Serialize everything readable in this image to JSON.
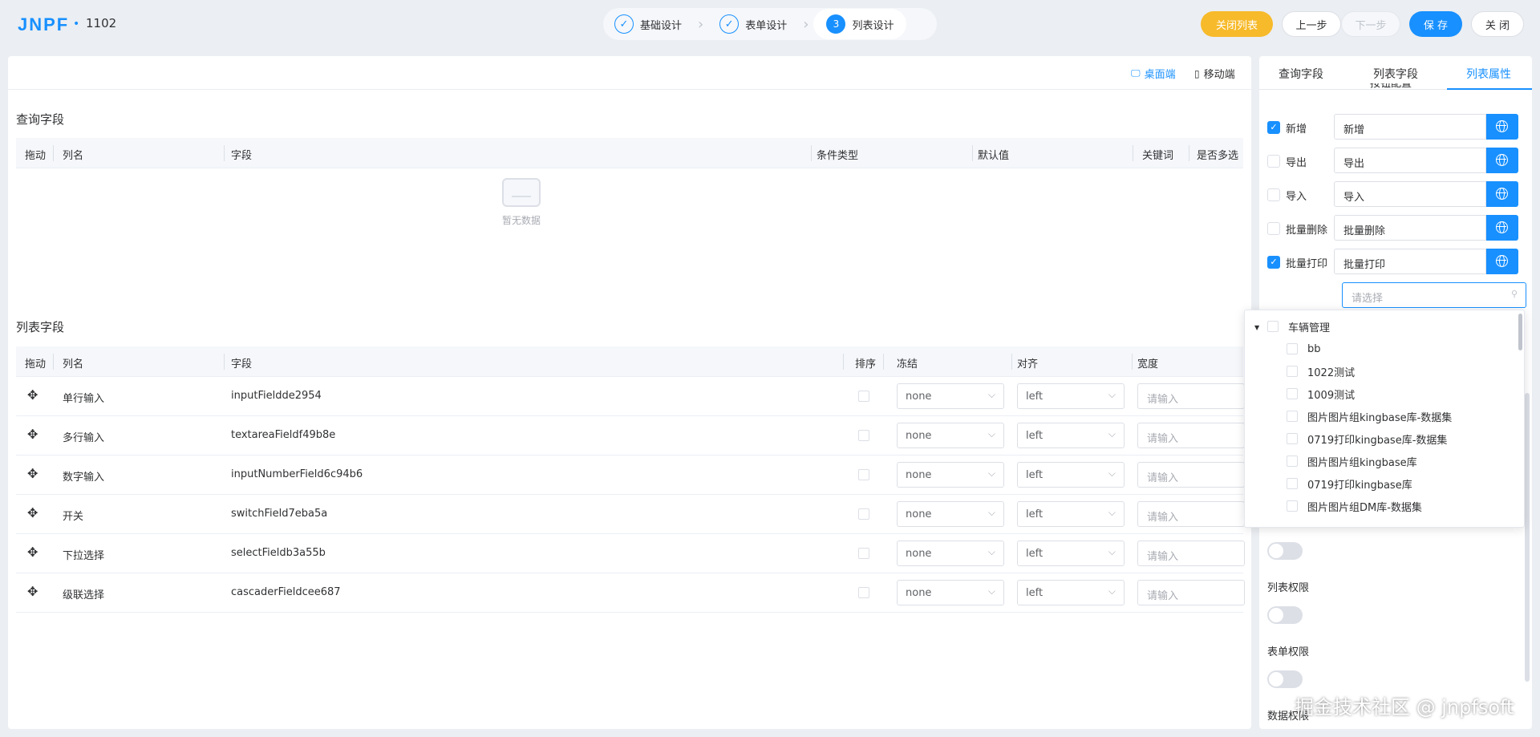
{
  "header": {
    "logo": "JNPF",
    "logo_dot": "•",
    "app_name": "1102",
    "steps": [
      {
        "label": "基础设计",
        "status": "done"
      },
      {
        "label": "表单设计",
        "status": "done"
      },
      {
        "label": "列表设计",
        "status": "active",
        "number": "3"
      }
    ],
    "buttons": {
      "close_list": "关闭列表",
      "prev": "上一步",
      "next": "下一步",
      "save": "保 存",
      "close": "关 闭"
    }
  },
  "device_toggle": {
    "desktop": "桌面端",
    "mobile": "移动端",
    "active": "desktop"
  },
  "query_section": {
    "title": "查询字段",
    "columns": [
      "拖动",
      "列名",
      "字段",
      "条件类型",
      "默认值",
      "关键词",
      "是否多选"
    ],
    "empty_text": "暂无数据"
  },
  "list_section": {
    "title": "列表字段",
    "columns": [
      "拖动",
      "列名",
      "字段",
      "排序",
      "冻结",
      "对齐",
      "宽度"
    ],
    "rows": [
      {
        "name": "单行输入",
        "field": "inputFieldde2954",
        "freeze": "none",
        "align": "left",
        "width_placeholder": "请输入"
      },
      {
        "name": "多行输入",
        "field": "textareaFieldf49b8e",
        "freeze": "none",
        "align": "left",
        "width_placeholder": "请输入"
      },
      {
        "name": "数字输入",
        "field": "inputNumberField6c94b6",
        "freeze": "none",
        "align": "left",
        "width_placeholder": "请输入"
      },
      {
        "name": "开关",
        "field": "switchField7eba5a",
        "freeze": "none",
        "align": "left",
        "width_placeholder": "请输入"
      },
      {
        "name": "下拉选择",
        "field": "selectFieldb3a55b",
        "freeze": "none",
        "align": "left",
        "width_placeholder": "请输入"
      },
      {
        "name": "级联选择",
        "field": "cascaderFieldcee687",
        "freeze": "none",
        "align": "left",
        "width_placeholder": "请输入"
      }
    ]
  },
  "right_panel": {
    "tabs": [
      "查询字段",
      "列表字段",
      "列表属性"
    ],
    "active_tab": "列表属性",
    "sub_heading": "按钮配置",
    "buttons": [
      {
        "label": "新增",
        "value": "新增",
        "checked": true
      },
      {
        "label": "导出",
        "value": "导出",
        "checked": false
      },
      {
        "label": "导入",
        "value": "导入",
        "checked": false
      },
      {
        "label": "批量删除",
        "value": "批量删除",
        "checked": false
      },
      {
        "label": "批量打印",
        "value": "批量打印",
        "checked": true
      }
    ],
    "select_placeholder": "请选择",
    "permissions": [
      "列表权限",
      "表单权限",
      "数据权限"
    ]
  },
  "tree_dropdown": {
    "root": "车辆管理",
    "children": [
      "bb",
      "1022测试",
      "1009测试",
      "图片图片组kingbase库-数据集",
      "0719打印kingbase库-数据集",
      "图片图片组kingbase库",
      "0719打印kingbase库",
      "图片图片组DM库-数据集"
    ]
  },
  "watermark": "掘金技术社区 @ jnpfsoft",
  "colors": {
    "primary": "#1890ff",
    "warning": "#f7ba2a",
    "background": "#ebeef2"
  }
}
